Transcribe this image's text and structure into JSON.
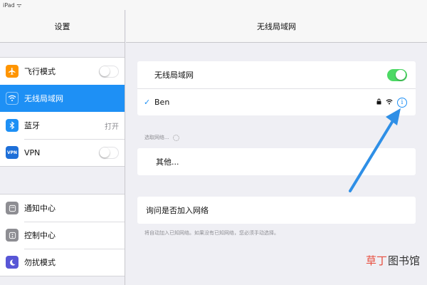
{
  "statusbar": {
    "device": "iPad ᯤ"
  },
  "sidebar": {
    "title": "设置",
    "groups": [
      [
        {
          "label": "飞行模式",
          "icon": "airplane-icon",
          "color": "#ff9500",
          "toggle": "off"
        },
        {
          "label": "无线局域网",
          "icon": "wifi-icon",
          "color": "#1e90f5",
          "selected": true
        },
        {
          "label": "蓝牙",
          "icon": "bluetooth-icon",
          "color": "#1e90f5",
          "value": "打开"
        },
        {
          "label": "VPN",
          "icon": "vpn-icon",
          "color": "#1e6fd8",
          "toggle": "off"
        }
      ],
      [
        {
          "label": "通知中心",
          "icon": "notification-center-icon",
          "color": "#8e8e93"
        },
        {
          "label": "控制中心",
          "icon": "control-center-icon",
          "color": "#8e8e93"
        },
        {
          "label": "勿扰模式",
          "icon": "do-not-disturb-icon",
          "color": "#5856d6"
        }
      ]
    ],
    "vpn_badge": "VPN"
  },
  "main": {
    "title": "无线局域网",
    "wifi_label": "无线局域网",
    "wifi_on": true,
    "current_network": "Ben",
    "info_glyph": "i",
    "choose_network_label": "选取网络...",
    "other_label": "其他...",
    "ask_join_label": "询问是否加入网络",
    "footnote": "将自动加入已知网络。如果没有已知网络，您必须手动选择。"
  },
  "watermark": {
    "accent": "草丁",
    "rest": "图书馆"
  },
  "colors": {
    "accent": "#1e90f5",
    "toggle_on": "#4cd964",
    "arrow": "#2f8fe6"
  }
}
